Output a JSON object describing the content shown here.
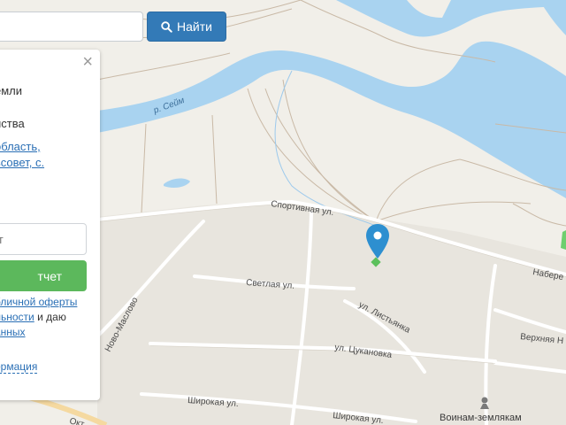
{
  "search": {
    "placeholder": "",
    "button_label": "Найти",
    "button_icon": "search-icon",
    "button_color": "#337ab7"
  },
  "panel": {
    "close_icon": "close-icon",
    "line1": "емли",
    "line2": "йства",
    "address_line1": " область,",
    "address_line2": "ьсовет, с.",
    "field_placeholder": "ет",
    "report_button": "тчет",
    "report_button_color": "#5cb85c",
    "offer_link": "бличной оферты",
    "consent_link": "льности",
    "consent_text": " и даю",
    "data_link": "анных",
    "info_link": "ормация"
  },
  "map": {
    "river_name": "р. Сейм",
    "streets": {
      "sportivnaya": "Спортивная ул.",
      "svetlaya": "Светлая ул.",
      "listyanka": "ул. Листьянка",
      "tsukanovka": "ул. Цукановка",
      "shirokaya1": "Широкая ул.",
      "shirokaya2": "Широкая ул.",
      "novo_maslovo": "Ново-Маслово",
      "naberezhnaya": "Набере",
      "verkhnyaya": "Верхняя Н",
      "oktyabrskaya": "Окт"
    },
    "landmark": "Воинам-землякам",
    "landmark_icon": "monument-icon",
    "marker_icon": "map-pin-icon",
    "colors": {
      "water": "#a9d3f0",
      "land": "#f1efe9",
      "settlement": "#e9e6df",
      "marker": "#2d8fd0",
      "plot": "#5cc05c"
    }
  }
}
